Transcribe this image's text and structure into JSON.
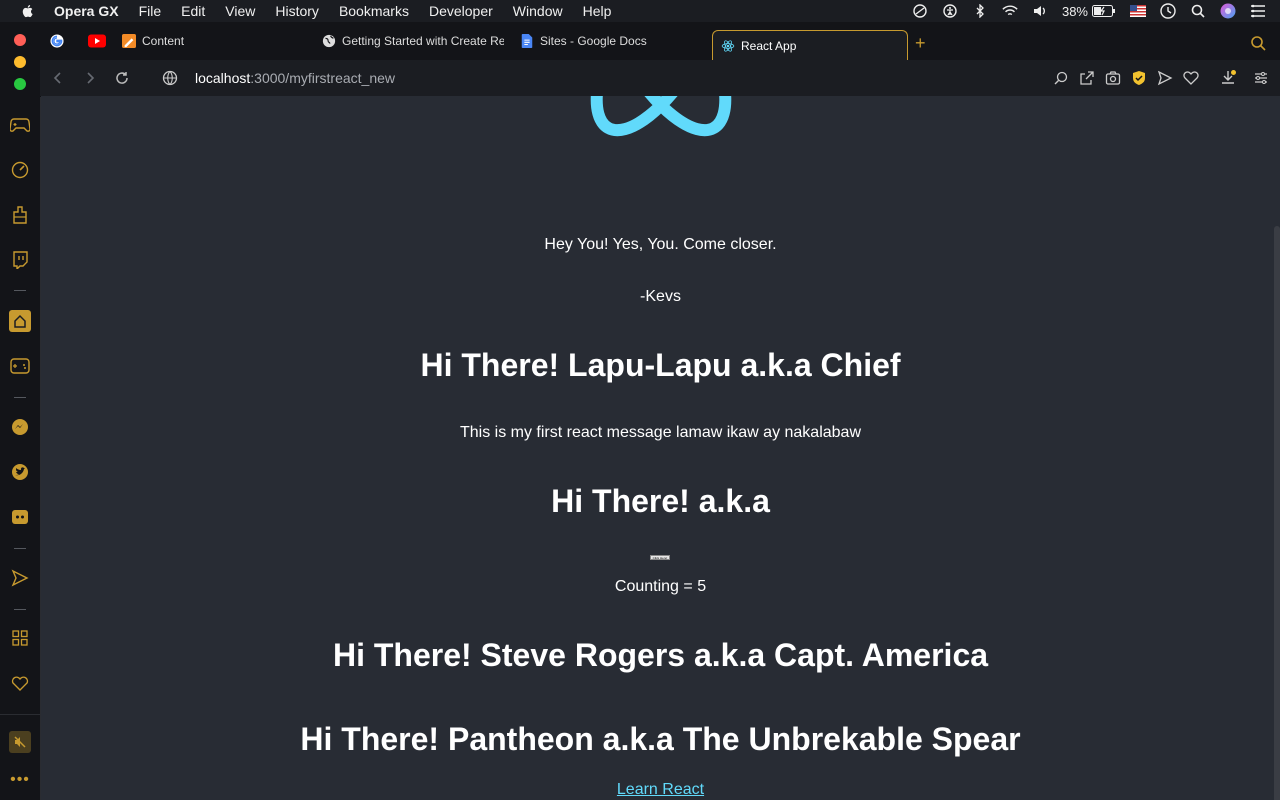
{
  "menubar": {
    "app_name": "Opera GX",
    "items": [
      "File",
      "Edit",
      "View",
      "History",
      "Bookmarks",
      "Developer",
      "Window",
      "Help"
    ],
    "battery": "38%"
  },
  "tabs": [
    {
      "label": "",
      "icon": "google-icon"
    },
    {
      "label": "",
      "icon": "youtube-icon"
    },
    {
      "label": "Content",
      "icon": "content-icon"
    },
    {
      "label": "Getting Started with Create Re",
      "icon": "globe-icon"
    },
    {
      "label": "Sites - Google Docs",
      "icon": "docs-icon"
    },
    {
      "label": "React App",
      "icon": "react-icon",
      "active": true
    }
  ],
  "address": {
    "host": "localhost",
    "path": ":3000/myfirstreact_new"
  },
  "page": {
    "line1": "Hey You! Yes, You. Come closer.",
    "line2": "-Kevs",
    "heading1": "Hi There! Lapu-Lapu a.k.a Chief",
    "message": "This is my first react message lamaw ikaw ay nakalabaw",
    "heading2": "Hi There! a.k.a",
    "button_label": "Click Here!",
    "counting": "Counting = 5",
    "heading3": "Hi There! Steve Rogers a.k.a Capt. America",
    "heading4": "Hi There! Pantheon a.k.a The Unbrekable Spear",
    "link": "Learn React"
  },
  "colors": {
    "accent": "#c79a2f",
    "react": "#61dafb",
    "background": "#282c34"
  }
}
